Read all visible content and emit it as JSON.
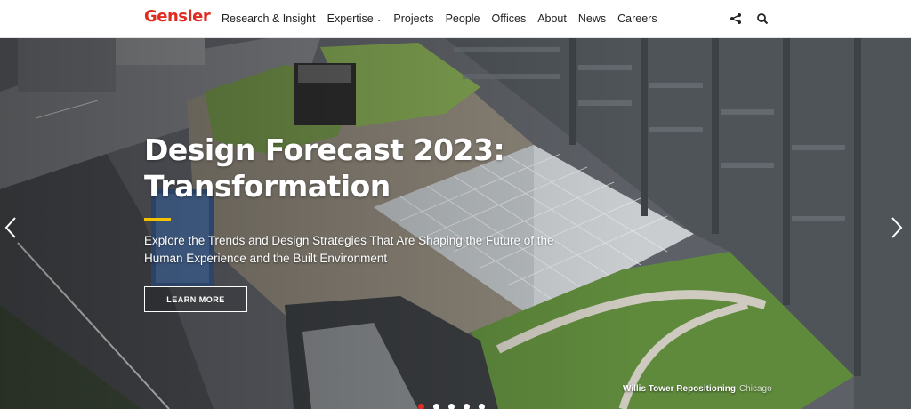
{
  "brand": {
    "logo": "Gensler",
    "color": "#e02b20"
  },
  "nav": {
    "items": [
      {
        "label": "Research & Insight",
        "dropdown": false
      },
      {
        "label": "Expertise",
        "dropdown": true
      },
      {
        "label": "Projects",
        "dropdown": false
      },
      {
        "label": "People",
        "dropdown": false
      },
      {
        "label": "Offices",
        "dropdown": false
      },
      {
        "label": "About",
        "dropdown": false
      },
      {
        "label": "News",
        "dropdown": false
      },
      {
        "label": "Careers",
        "dropdown": false
      }
    ],
    "icons": [
      "share-icon",
      "search-icon"
    ]
  },
  "hero": {
    "headline_line1": "Design Forecast 2023:",
    "headline_line2": "Transformation",
    "subtext": "Explore the Trends and Design Strategies That Are Shaping the Future of the Human Experience and the Built Environment",
    "cta_label": "LEARN MORE",
    "accent_color": "#f2c200",
    "caption_title": "Willis Tower Repositioning",
    "caption_place": "Chicago",
    "slide_count": 5,
    "active_slide": 1
  }
}
